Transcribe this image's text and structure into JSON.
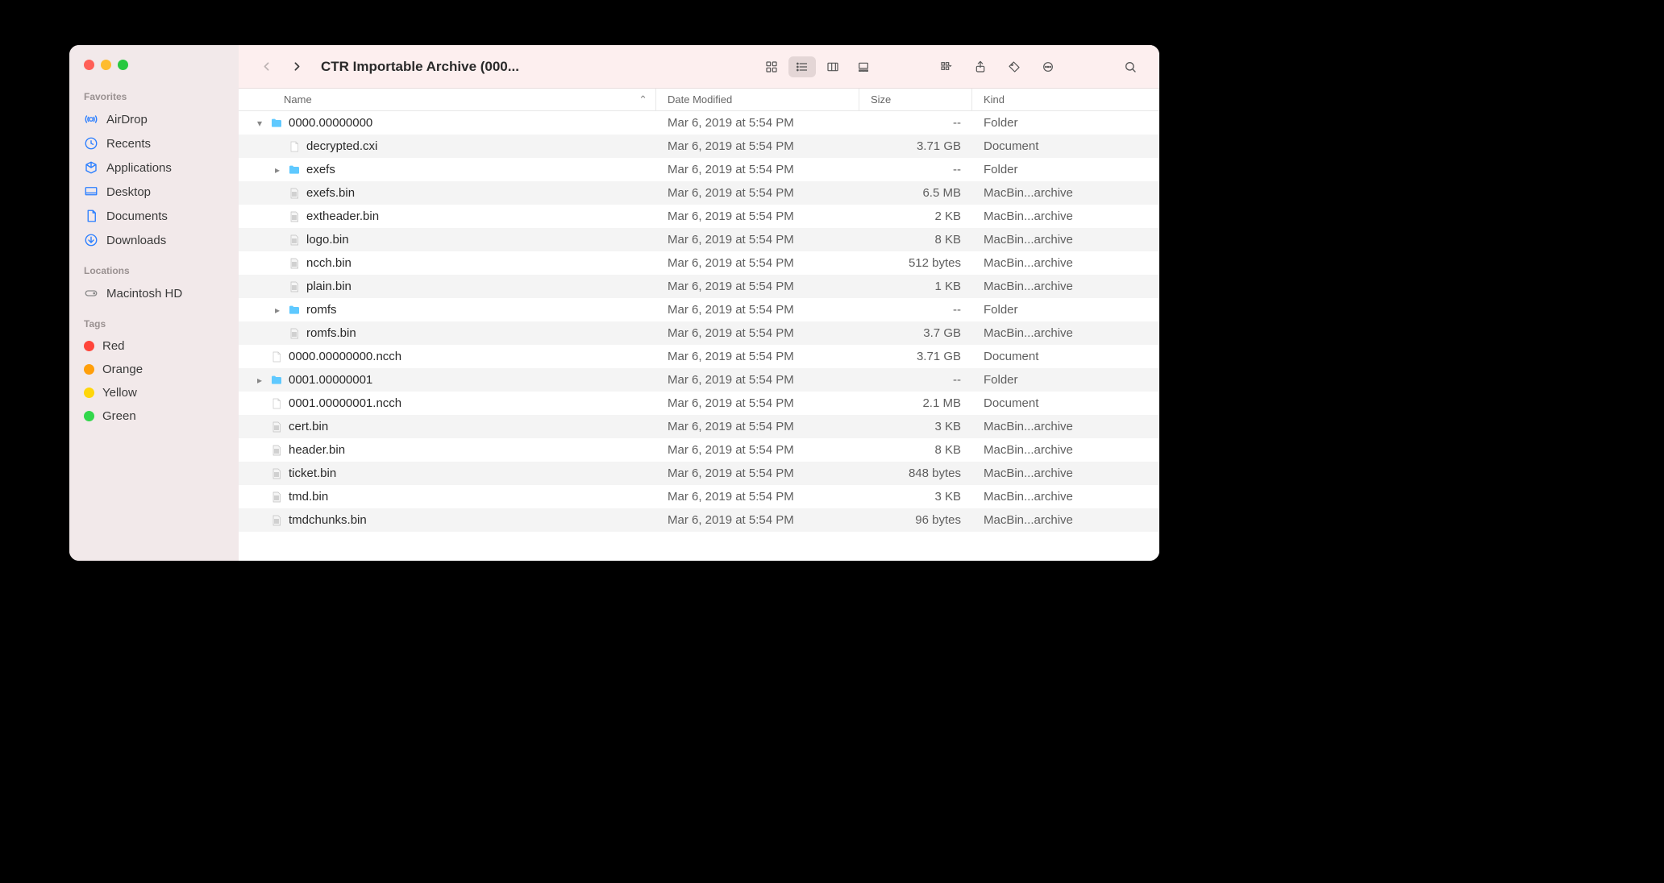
{
  "window": {
    "title": "CTR Importable Archive (000..."
  },
  "sidebar": {
    "sections": [
      {
        "label": "Favorites",
        "items": [
          {
            "icon": "airdrop",
            "label": "AirDrop"
          },
          {
            "icon": "recents",
            "label": "Recents"
          },
          {
            "icon": "apps",
            "label": "Applications"
          },
          {
            "icon": "desktop",
            "label": "Desktop"
          },
          {
            "icon": "docs",
            "label": "Documents"
          },
          {
            "icon": "downloads",
            "label": "Downloads"
          }
        ]
      },
      {
        "label": "Locations",
        "items": [
          {
            "icon": "disk",
            "label": "Macintosh HD"
          }
        ]
      },
      {
        "label": "Tags",
        "items": [
          {
            "icon": "tag-red",
            "label": "Red"
          },
          {
            "icon": "tag-orange",
            "label": "Orange"
          },
          {
            "icon": "tag-yellow",
            "label": "Yellow"
          },
          {
            "icon": "tag-green",
            "label": "Green"
          }
        ]
      }
    ]
  },
  "columns": {
    "name": "Name",
    "date": "Date Modified",
    "size": "Size",
    "kind": "Kind"
  },
  "rows": [
    {
      "indent": 0,
      "disclosure": "down",
      "icon": "folder",
      "name": "0000.00000000",
      "date": "Mar 6, 2019 at 5:54 PM",
      "size": "--",
      "kind": "Folder"
    },
    {
      "indent": 1,
      "disclosure": "",
      "icon": "doc",
      "name": "decrypted.cxi",
      "date": "Mar 6, 2019 at 5:54 PM",
      "size": "3.71 GB",
      "kind": "Document"
    },
    {
      "indent": 1,
      "disclosure": "right",
      "icon": "folder",
      "name": "exefs",
      "date": "Mar 6, 2019 at 5:54 PM",
      "size": "--",
      "kind": "Folder"
    },
    {
      "indent": 1,
      "disclosure": "",
      "icon": "bin",
      "name": "exefs.bin",
      "date": "Mar 6, 2019 at 5:54 PM",
      "size": "6.5 MB",
      "kind": "MacBin...archive"
    },
    {
      "indent": 1,
      "disclosure": "",
      "icon": "bin",
      "name": "extheader.bin",
      "date": "Mar 6, 2019 at 5:54 PM",
      "size": "2 KB",
      "kind": "MacBin...archive"
    },
    {
      "indent": 1,
      "disclosure": "",
      "icon": "bin",
      "name": "logo.bin",
      "date": "Mar 6, 2019 at 5:54 PM",
      "size": "8 KB",
      "kind": "MacBin...archive"
    },
    {
      "indent": 1,
      "disclosure": "",
      "icon": "bin",
      "name": "ncch.bin",
      "date": "Mar 6, 2019 at 5:54 PM",
      "size": "512 bytes",
      "kind": "MacBin...archive"
    },
    {
      "indent": 1,
      "disclosure": "",
      "icon": "bin",
      "name": "plain.bin",
      "date": "Mar 6, 2019 at 5:54 PM",
      "size": "1 KB",
      "kind": "MacBin...archive"
    },
    {
      "indent": 1,
      "disclosure": "right",
      "icon": "folder",
      "name": "romfs",
      "date": "Mar 6, 2019 at 5:54 PM",
      "size": "--",
      "kind": "Folder"
    },
    {
      "indent": 1,
      "disclosure": "",
      "icon": "bin",
      "name": "romfs.bin",
      "date": "Mar 6, 2019 at 5:54 PM",
      "size": "3.7 GB",
      "kind": "MacBin...archive"
    },
    {
      "indent": 0,
      "disclosure": "",
      "icon": "doc",
      "name": "0000.00000000.ncch",
      "date": "Mar 6, 2019 at 5:54 PM",
      "size": "3.71 GB",
      "kind": "Document"
    },
    {
      "indent": 0,
      "disclosure": "right",
      "icon": "folder",
      "name": "0001.00000001",
      "date": "Mar 6, 2019 at 5:54 PM",
      "size": "--",
      "kind": "Folder"
    },
    {
      "indent": 0,
      "disclosure": "",
      "icon": "doc",
      "name": "0001.00000001.ncch",
      "date": "Mar 6, 2019 at 5:54 PM",
      "size": "2.1 MB",
      "kind": "Document"
    },
    {
      "indent": 0,
      "disclosure": "",
      "icon": "bin",
      "name": "cert.bin",
      "date": "Mar 6, 2019 at 5:54 PM",
      "size": "3 KB",
      "kind": "MacBin...archive"
    },
    {
      "indent": 0,
      "disclosure": "",
      "icon": "bin",
      "name": "header.bin",
      "date": "Mar 6, 2019 at 5:54 PM",
      "size": "8 KB",
      "kind": "MacBin...archive"
    },
    {
      "indent": 0,
      "disclosure": "",
      "icon": "bin",
      "name": "ticket.bin",
      "date": "Mar 6, 2019 at 5:54 PM",
      "size": "848 bytes",
      "kind": "MacBin...archive"
    },
    {
      "indent": 0,
      "disclosure": "",
      "icon": "bin",
      "name": "tmd.bin",
      "date": "Mar 6, 2019 at 5:54 PM",
      "size": "3 KB",
      "kind": "MacBin...archive"
    },
    {
      "indent": 0,
      "disclosure": "",
      "icon": "bin",
      "name": "tmdchunks.bin",
      "date": "Mar 6, 2019 at 5:54 PM",
      "size": "96 bytes",
      "kind": "MacBin...archive"
    }
  ]
}
